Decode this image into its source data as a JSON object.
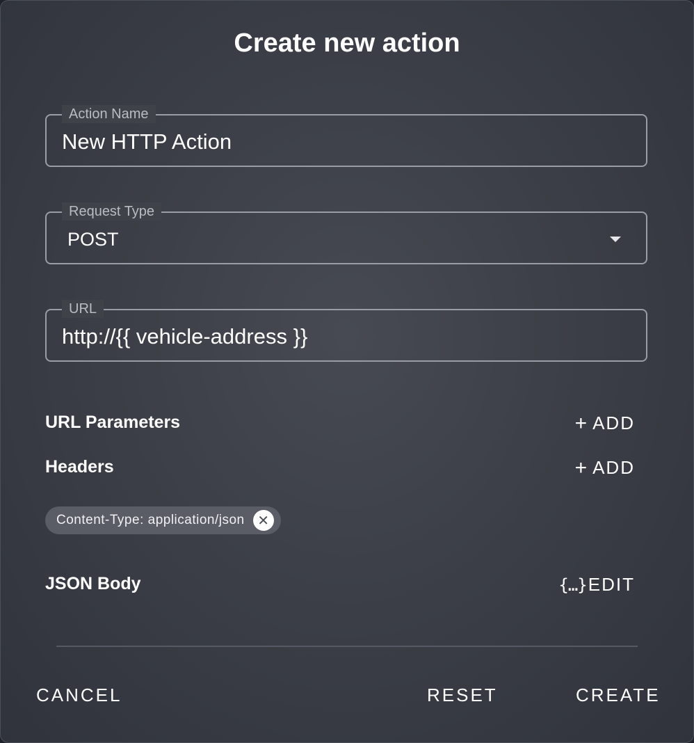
{
  "dialog": {
    "title": "Create new action"
  },
  "fields": {
    "action_name": {
      "label": "Action Name",
      "value": "New HTTP Action"
    },
    "request_type": {
      "label": "Request Type",
      "value": "POST"
    },
    "url": {
      "label": "URL",
      "value": "http://{{ vehicle-address }}"
    }
  },
  "sections": {
    "url_parameters": {
      "label": "URL Parameters",
      "add_label": "ADD",
      "add_icon": "plus-icon"
    },
    "headers": {
      "label": "Headers",
      "add_label": "ADD",
      "add_icon": "plus-icon",
      "chips": [
        {
          "label": "Content-Type: application/json",
          "icon": "close-circle-icon"
        }
      ]
    },
    "json_body": {
      "label": "JSON Body",
      "edit_label": "EDIT",
      "edit_icon": "braces-icon"
    }
  },
  "footer": {
    "cancel_label": "CANCEL",
    "reset_label": "RESET",
    "create_label": "CREATE"
  }
}
